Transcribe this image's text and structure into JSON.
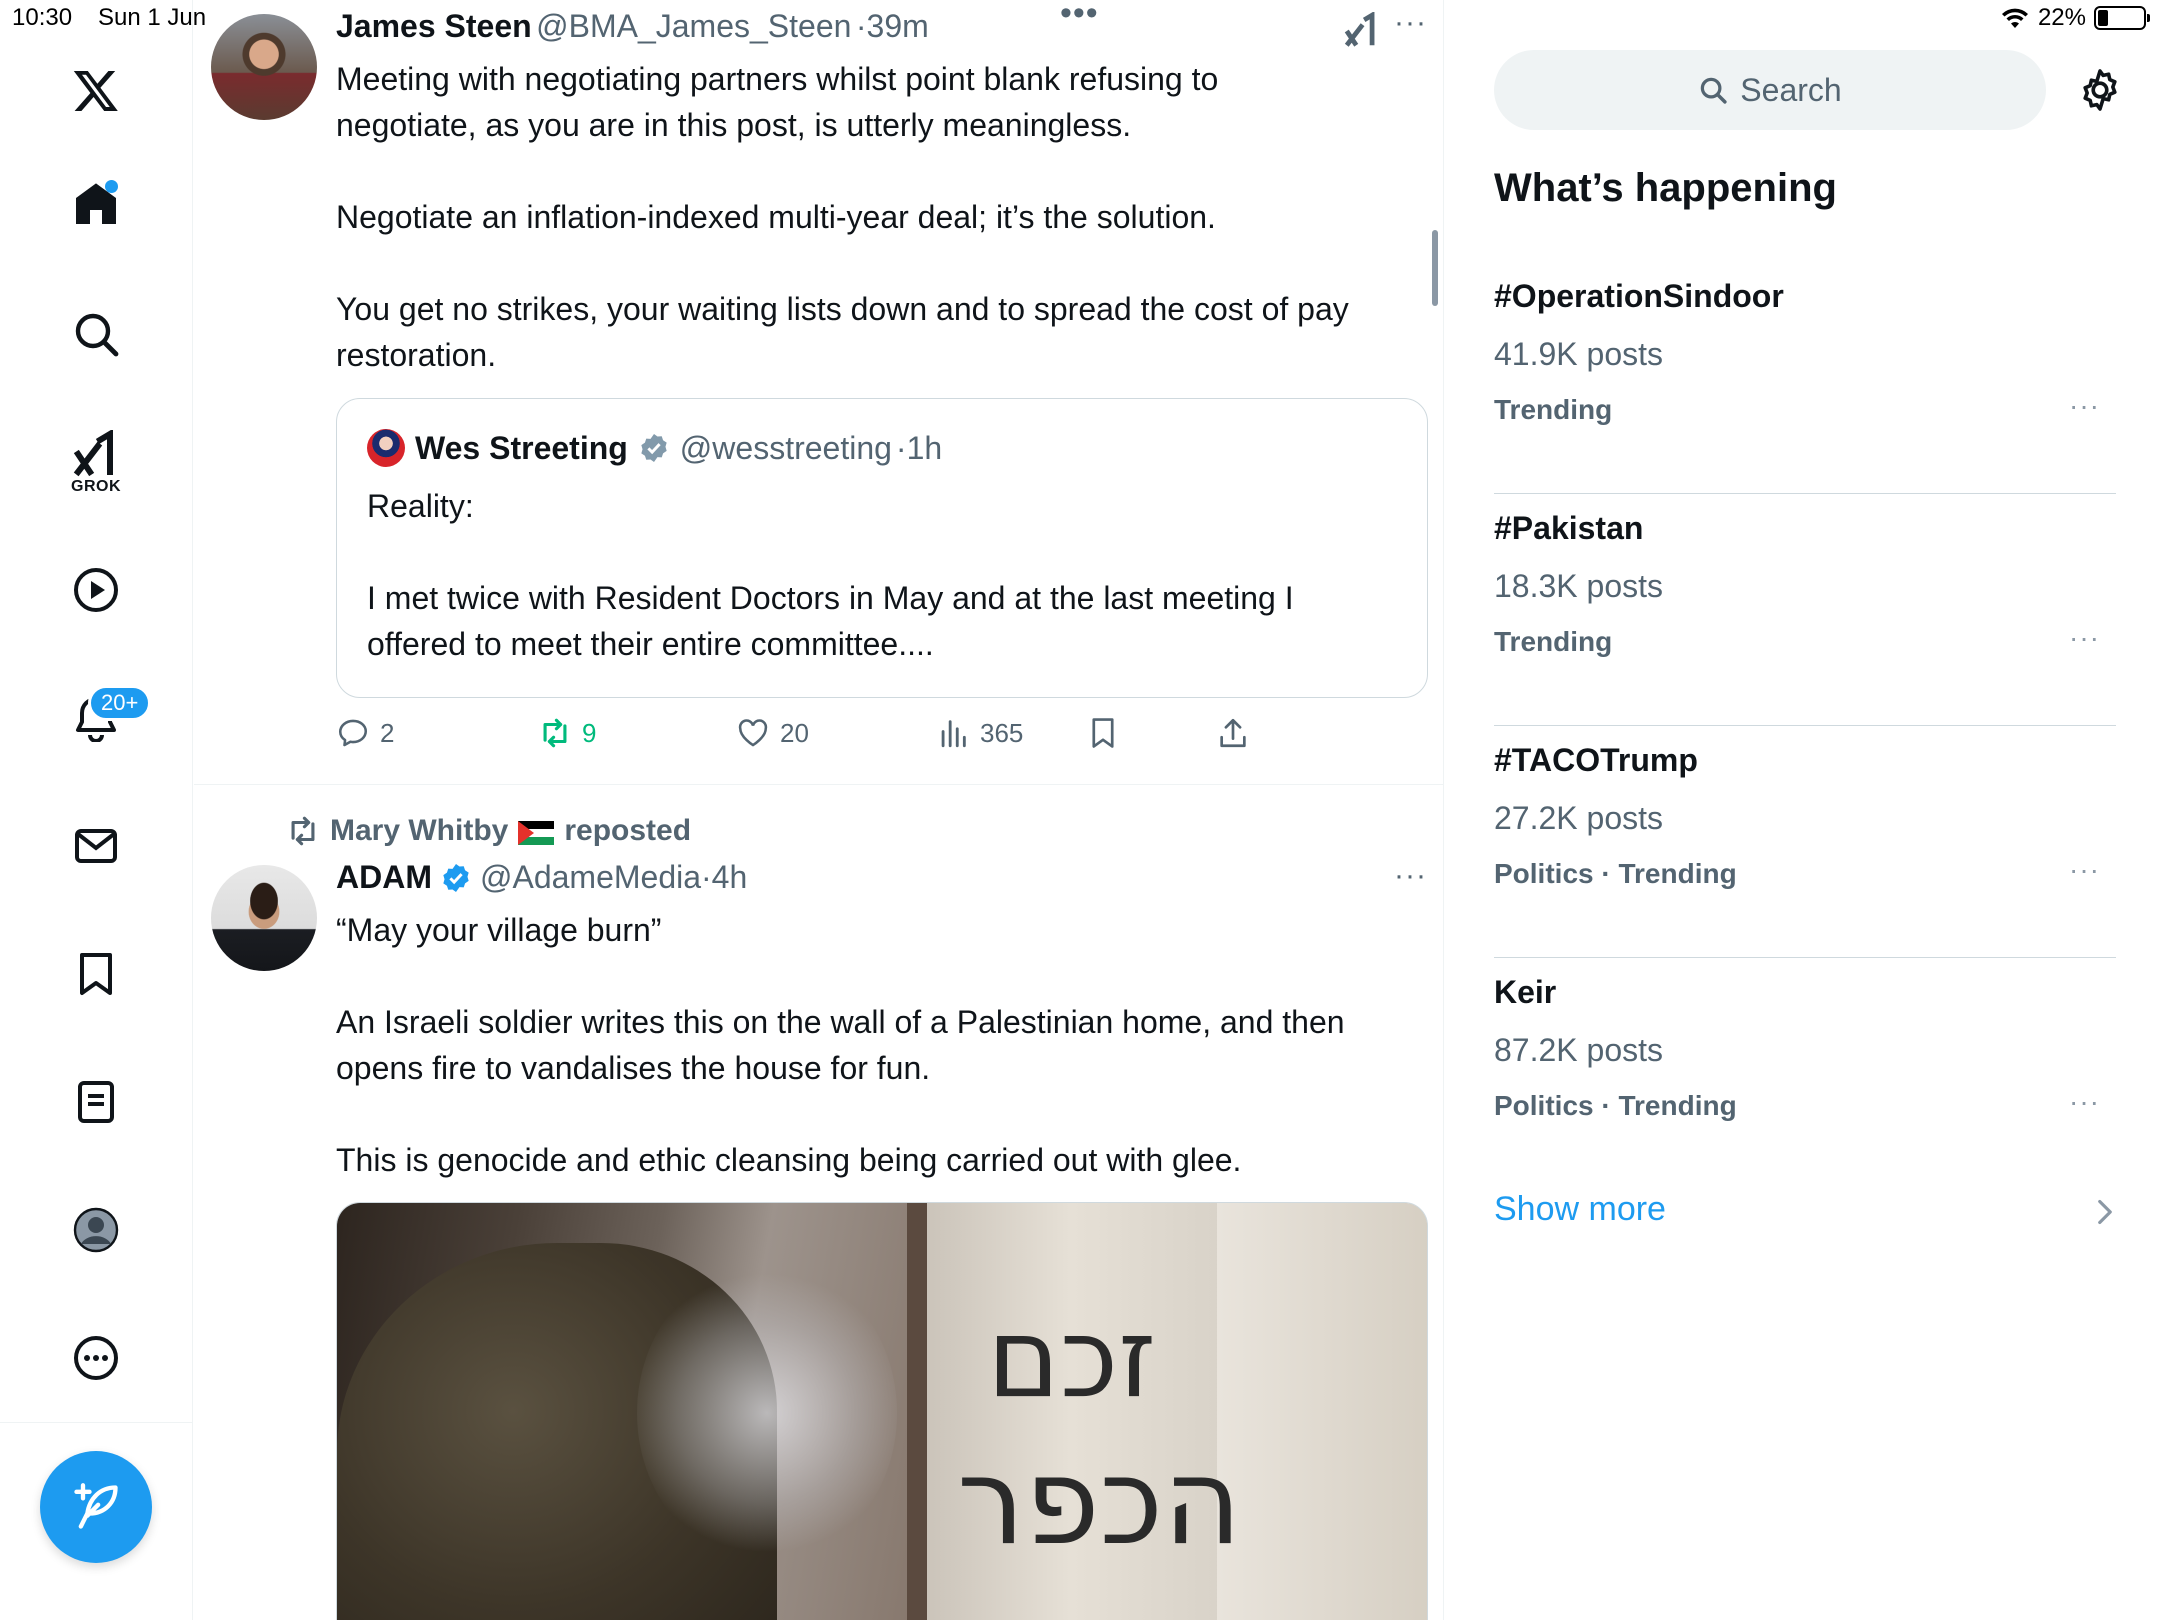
{
  "status_bar": {
    "time": "10:30",
    "date": "Sun 1 Jun",
    "battery": "22%",
    "battery_level": 0.22
  },
  "nav": {
    "items": [
      "x-logo",
      "home",
      "search",
      "grok",
      "videos",
      "notifications",
      "messages",
      "bookmarks",
      "lists",
      "profile",
      "more"
    ],
    "grok_label": "GROK",
    "notification_badge": "20+"
  },
  "main": {
    "more_indicator": "•••",
    "tweet1": {
      "name": "James Steen",
      "handle": "@BMA_James_Steen",
      "time": "39m",
      "text": "Meeting with negotiating partners whilst point blank refusing to\nnegotiate, as you are in this post, is utterly meaningless.\n\nNegotiate an inflation-indexed multi-year deal; it’s the solution.\n\nYou get no strikes, your waiting lists down and to spread the cost of pay\nrestoration.",
      "quote": {
        "name": "Wes Streeting",
        "handle": "@wesstreeting",
        "time": "1h",
        "text": "Reality:\n\nI met twice with Resident Doctors in May and at the last meeting I\noffered to meet their entire committee...."
      },
      "actions": {
        "replies": "2",
        "reposts": "9",
        "likes": "20",
        "views": "365"
      }
    },
    "tweet2": {
      "reposted_by": "Mary Whitby",
      "reposted_suffix": "reposted",
      "name": "ADAM",
      "handle": "@AdameMedia",
      "time": "4h",
      "text": "“May your village burn”\n\nAn Israeli soldier writes this on the wall of a Palestinian home, and then\nopens fire to vandalises the house for fun.\n\nThis is genocide and ethic cleansing being carried out with glee.",
      "media_graffiti_line1": "זכם",
      "media_graffiti_line2": "הכפר"
    }
  },
  "sidebar": {
    "search_placeholder": "Search",
    "title": "What’s happening",
    "trends": [
      {
        "name": "#OperationSindoor",
        "count": "41.9K posts",
        "category": "Trending"
      },
      {
        "name": "#Pakistan",
        "count": "18.3K posts",
        "category": "Trending"
      },
      {
        "name": "#TACOTrump",
        "count": "27.2K posts",
        "category": "Politics · Trending"
      },
      {
        "name": "Keir",
        "count": "87.2K posts",
        "category": "Politics · Trending"
      }
    ],
    "show_more": "Show more"
  }
}
